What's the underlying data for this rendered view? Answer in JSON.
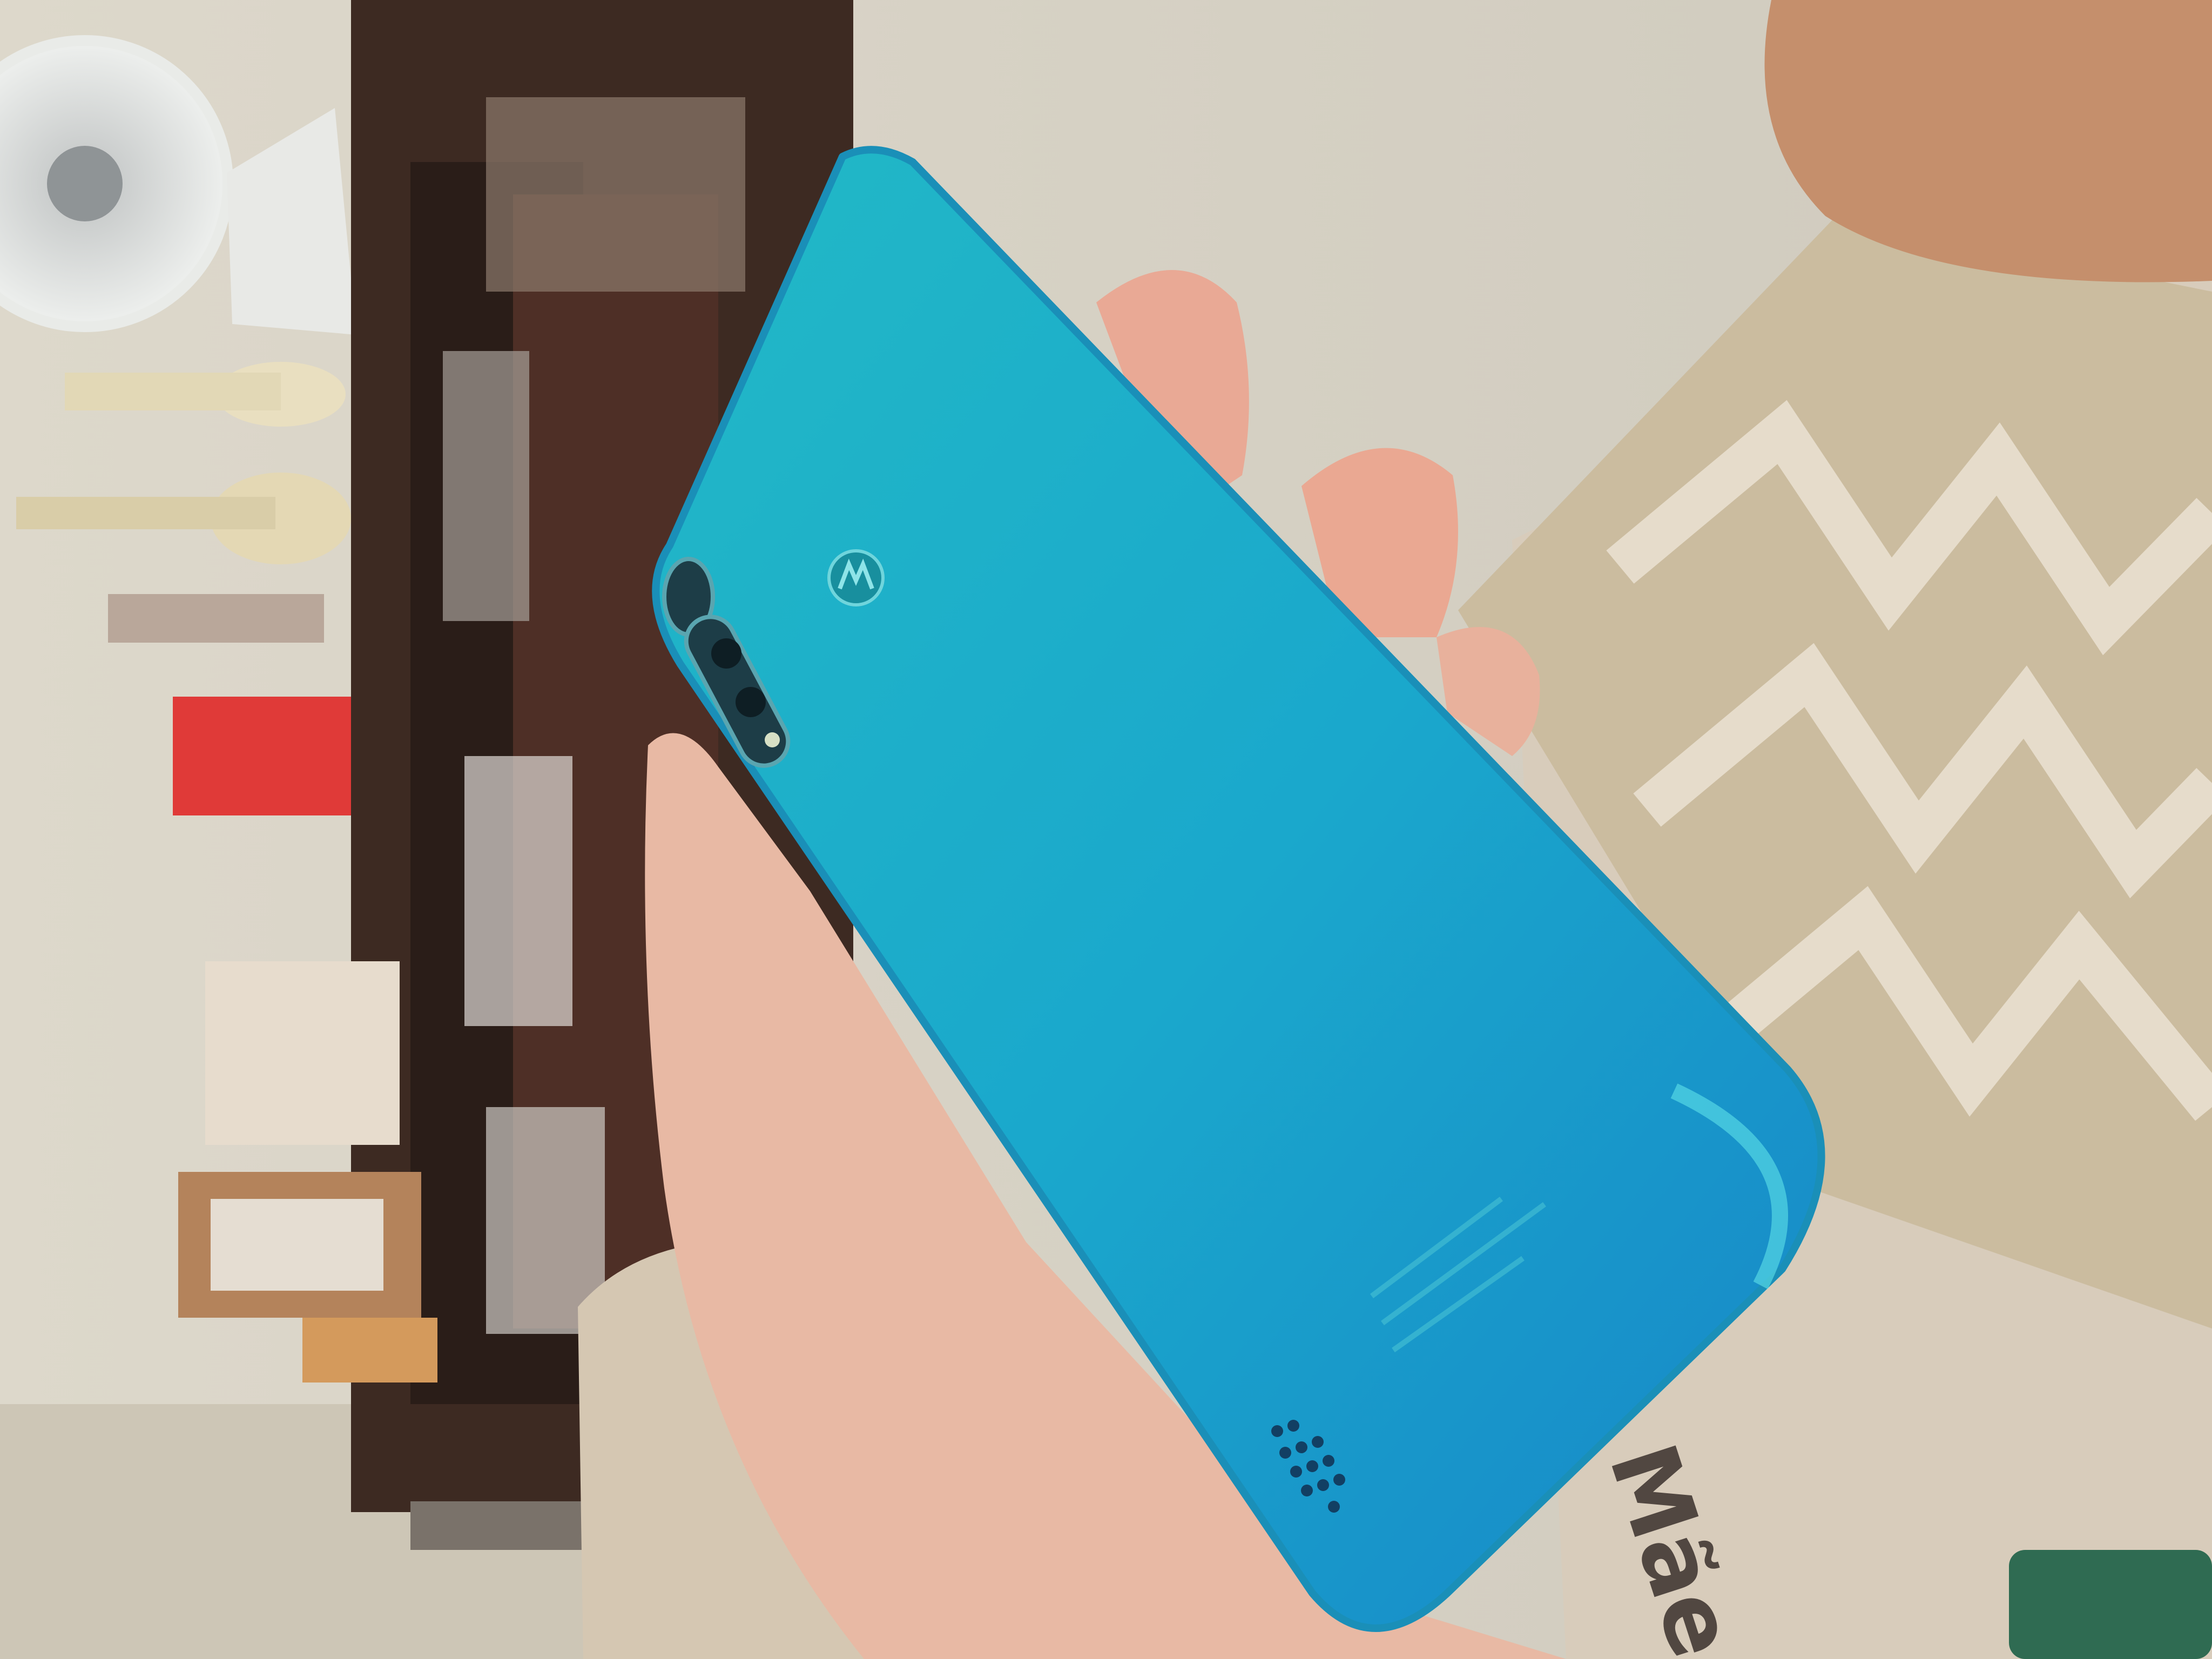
{
  "scene": {
    "subject": "Phone",
    "pillow_text": "Mãe"
  },
  "colors": {
    "wall": "#d8d3c6",
    "shelf": "#3e2a22",
    "phone_light": "#1fb6c8",
    "phone_dark": "#1a7fc4",
    "skin": "#e6b39c",
    "pillow": "#cfc2a8",
    "sofa": "#d8ccbb"
  }
}
